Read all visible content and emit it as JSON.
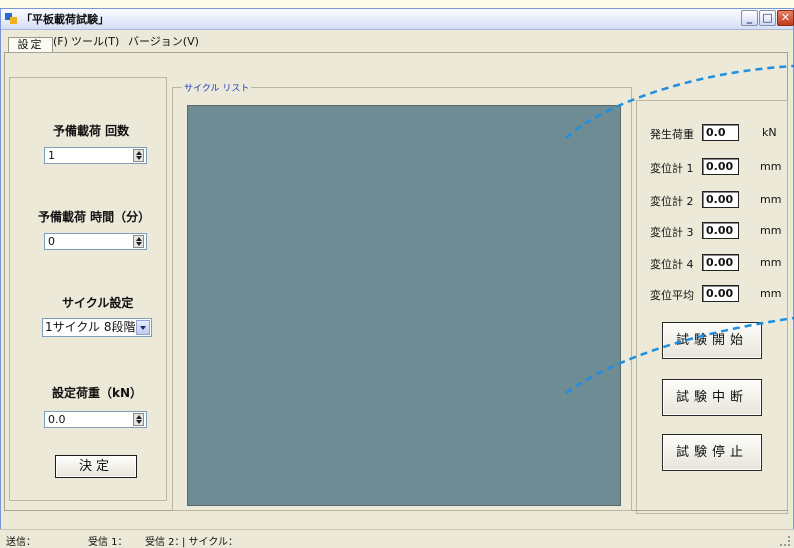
{
  "window": {
    "title": "「平板載荷試験」"
  },
  "menu": [
    "ファイル(F)",
    "ツール(T)",
    "バージョン(V)"
  ],
  "tabs": [
    "設定"
  ],
  "left_panel": {
    "preload_count_label": "予備載荷 回数",
    "preload_count_value": "1",
    "preload_time_label": "予備載荷 時間（分）",
    "preload_time_value": "0",
    "cycle_setting_label": "サイクル設定",
    "cycle_setting_value": "1サイクル 8段階",
    "set_load_label": "設定荷重（kN）",
    "set_load_value": "0.0",
    "decide_button": "決定"
  },
  "cycle_list": {
    "label": "サイクル リスト"
  },
  "readings": [
    {
      "label": "発生荷重",
      "value": "0.0",
      "unit": "kN"
    },
    {
      "label": "変位計 1",
      "value": "0.00",
      "unit": "mm"
    },
    {
      "label": "変位計 2",
      "value": "0.00",
      "unit": "mm"
    },
    {
      "label": "変位計 3",
      "value": "0.00",
      "unit": "mm"
    },
    {
      "label": "変位計 4",
      "value": "0.00",
      "unit": "mm"
    },
    {
      "label": "変位平均",
      "value": "0.00",
      "unit": "mm"
    }
  ],
  "actions": {
    "start": "試験開始",
    "pause": "試験中断",
    "stop": "試験停止"
  },
  "status": [
    "送信：",
    "受信 1：",
    "受信 2：",
    "| サイクル："
  ],
  "colors": {
    "list_background": "#6e8c93",
    "annotation_line": "#1e8fe0",
    "close_button": "#c23a1e"
  }
}
